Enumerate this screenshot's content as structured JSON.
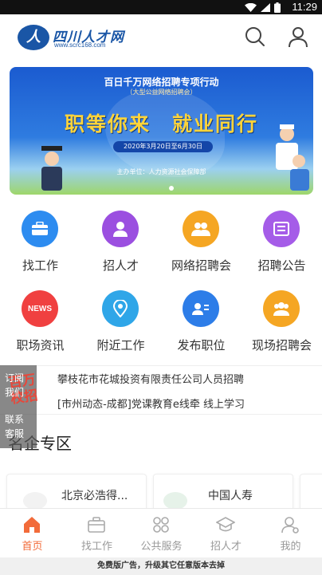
{
  "status_bar": {
    "time": "11:29"
  },
  "header": {
    "logo_text": "四川人才网",
    "logo_url": "www.scrc168.com",
    "logo_mark": "人"
  },
  "banner": {
    "title": "百日千万网络招聘专项行动",
    "subtitle": "（大型公益网络招聘会）",
    "headline": "职等你来　就业同行",
    "date_range": "2020年3月20日至6月30日",
    "organizer": "主办单位：人力资源社会保障部"
  },
  "shortcuts": [
    {
      "label": "找工作",
      "icon": "briefcase-icon",
      "color": "#2d8cf0"
    },
    {
      "label": "招人才",
      "icon": "person-badge-icon",
      "color": "#9b4fe0"
    },
    {
      "label": "网络招聘会",
      "icon": "group-icon",
      "color": "#f5a623"
    },
    {
      "label": "招聘公告",
      "icon": "announcement-icon",
      "color": "#a55ce8"
    },
    {
      "label": "职场资讯",
      "icon": "news-icon",
      "color": "#f04040"
    },
    {
      "label": "附近工作",
      "icon": "location-icon",
      "color": "#2fa6e8"
    },
    {
      "label": "发布职位",
      "icon": "post-job-icon",
      "color": "#2d7de8"
    },
    {
      "label": "现场招聘会",
      "icon": "crowd-icon",
      "color": "#f5a623"
    }
  ],
  "ticker": [
    "攀枝花市花城投资有限责任公司人员招聘",
    "[市州动态-成都]党课教育e线牵 线上学习"
  ],
  "floating_ad": {
    "line1": "订阅",
    "line2": "我们",
    "line3": "联系",
    "line4": "客服",
    "promo": "百万校招"
  },
  "section": {
    "title": "名企专区"
  },
  "company_cards": [
    {
      "name": "北京必浩得..."
    },
    {
      "name": "中国人寿"
    }
  ],
  "bottom_nav": [
    {
      "label": "首页",
      "icon": "home-icon",
      "active": true
    },
    {
      "label": "找工作",
      "icon": "briefcase-icon",
      "active": false
    },
    {
      "label": "公共服务",
      "icon": "grid-icon",
      "active": false
    },
    {
      "label": "招人才",
      "icon": "graduation-cap-icon",
      "active": false
    },
    {
      "label": "我的",
      "icon": "user-icon",
      "active": false
    }
  ],
  "ad_footer": "免费版广告，升级其它任意版本去掉",
  "colors": {
    "accent": "#f26b3a",
    "brand": "#1a56a6"
  }
}
